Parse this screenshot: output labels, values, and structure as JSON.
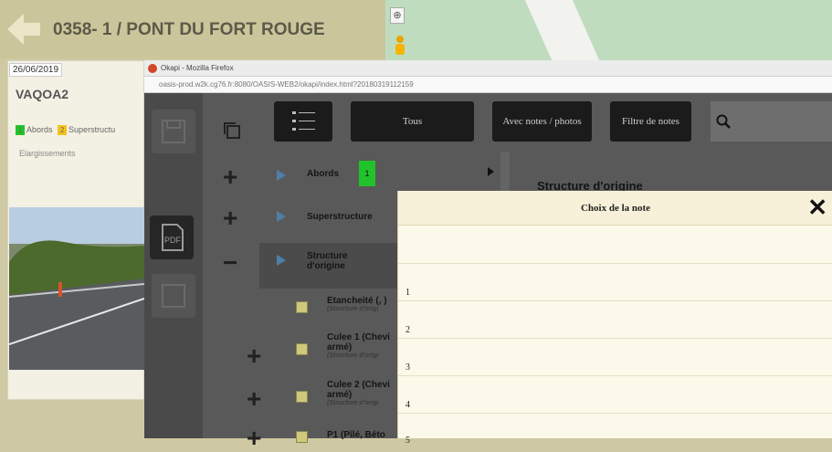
{
  "header": {
    "title": "0358- 1 / PONT DU FORT ROUGE"
  },
  "panel": {
    "date": "26/06/2019",
    "code": "VAQOA2",
    "legend": [
      {
        "num": "1",
        "label": "Abords",
        "color": "#22c32a"
      },
      {
        "num": "2",
        "label": "Superstructu",
        "color": "#f4c21b"
      }
    ],
    "legend_extra": "Elargissements"
  },
  "browser": {
    "window_title": "Okapi - Mozilla Firefox",
    "url": "oasis-prod.w2k.cg76.fr:8080/OASIS-WEB2/okapi/index.html?20180319112159"
  },
  "toolbar": {
    "tous": "Tous",
    "avec_notes": "Avec notes / photos",
    "filtre": "Filtre de notes"
  },
  "tree": {
    "abords": {
      "label": "Abords",
      "badge": "1",
      "badge_color": "#22c32a"
    },
    "superstructure": {
      "label": "Superstructure"
    },
    "structure": {
      "line1": "Structure",
      "line2": "d'origine"
    },
    "items": [
      {
        "line1": "Etancheité (, )",
        "sub": "(Structure d'origi"
      },
      {
        "line1": "Culee 1 (Chevi",
        "line2": "armé)",
        "sub": "(Structure d'origi"
      },
      {
        "line1": "Culee 2 (Chevi",
        "line2": "armé)",
        "sub": "(Structure d'origi"
      },
      {
        "line1": "P1 (Pilé, Béto"
      }
    ]
  },
  "detail": {
    "heading": "Structure d'origine"
  },
  "modal": {
    "title": "Choix de la note",
    "options": [
      "",
      "1",
      "2",
      "3",
      "4",
      "5"
    ]
  }
}
